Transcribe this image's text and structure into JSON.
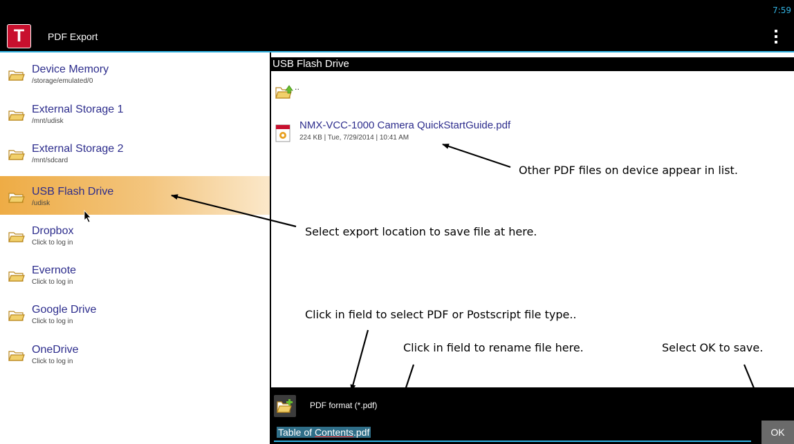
{
  "status_bar": {
    "clock": "7:59"
  },
  "app": {
    "logo_letter": "T",
    "title": "PDF Export"
  },
  "sidebar": {
    "items": [
      {
        "label": "Device Memory",
        "sub": "/storage/emulated/0"
      },
      {
        "label": "External Storage 1",
        "sub": "/mnt/udisk"
      },
      {
        "label": "External Storage 2",
        "sub": "/mnt/sdcard"
      },
      {
        "label": "USB Flash Drive",
        "sub": "/udisk",
        "selected": true
      },
      {
        "label": "Dropbox",
        "sub": "Click to log in"
      },
      {
        "label": "Evernote",
        "sub": "Click to log in"
      },
      {
        "label": "Google Drive",
        "sub": "Click to log in"
      },
      {
        "label": "OneDrive",
        "sub": "Click to log in"
      }
    ]
  },
  "main": {
    "header": "USB Flash Drive",
    "parent_label": "..",
    "files": [
      {
        "name": "NMX-VCC-1000 Camera QuickStartGuide.pdf",
        "meta": "224 KB | Tue, 7/29/2014 | 10:41 AM"
      }
    ]
  },
  "annotations": {
    "pdf_files": "Other PDF files on device appear in list.",
    "export_location": "Select export location to save file at here.",
    "file_type": "Click in field to select PDF or Postscript file type..",
    "rename": "Click in field to rename file here.",
    "ok_save": "Select OK to save."
  },
  "bottom": {
    "format": "PDF format (*.pdf)",
    "filename_part1": "Table of ",
    "filename_part2": "Contents",
    "filename_part3": ".pdf",
    "ok_label": "OK"
  },
  "colors": {
    "accent": "#33b5e5",
    "selected": "#eeac45",
    "link": "#2c2c8c",
    "logo": "#c8102e"
  },
  "icons": [
    "folder-icon",
    "folder-up-icon",
    "pdf-file-icon",
    "new-folder-icon",
    "overflow-menu-icon",
    "mouse-cursor-icon"
  ]
}
